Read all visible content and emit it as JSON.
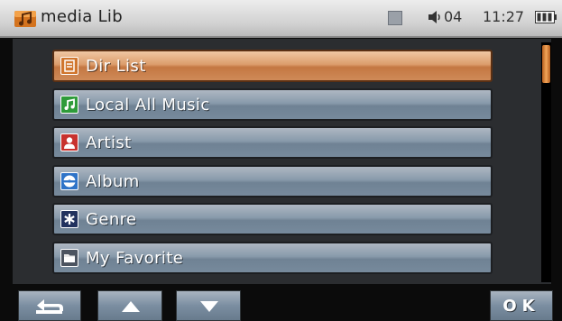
{
  "status_bar": {
    "app_title": "media Lib",
    "volume_level": "04",
    "time": "11:27"
  },
  "menu": {
    "items": [
      {
        "label": "Dir List",
        "icon": "list-icon",
        "selected": true
      },
      {
        "label": "Local All Music",
        "icon": "music-note-icon",
        "selected": false
      },
      {
        "label": "Artist",
        "icon": "person-icon",
        "selected": false
      },
      {
        "label": "Album",
        "icon": "disc-icon",
        "selected": false
      },
      {
        "label": "Genre",
        "icon": "asterisk-icon",
        "selected": false
      },
      {
        "label": "My Favorite",
        "icon": "folder-icon",
        "selected": false
      }
    ]
  },
  "scrollbar": {
    "position": 0
  },
  "buttons": {
    "back": {
      "icon": "back-arrow-icon"
    },
    "up": {
      "icon": "up-arrow-icon"
    },
    "down": {
      "icon": "down-arrow-icon"
    },
    "ok_label": "OK"
  },
  "colors": {
    "selected_item": "#c47742",
    "item": "#778a9c",
    "music_icon": "#2e9b3a",
    "artist_icon": "#c8322e",
    "album_icon": "#2f74c8",
    "genre_icon": "#22325e"
  }
}
